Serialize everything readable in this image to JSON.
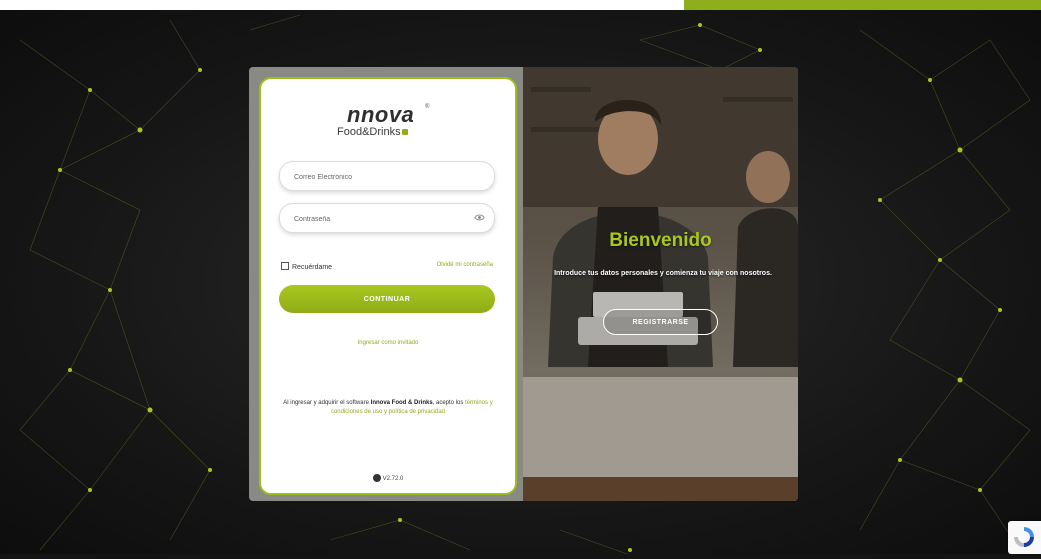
{
  "brand": {
    "logo_name": "nnova",
    "logo_sub": "Food&Drinks",
    "registered": "®",
    "accent_color": "#8fae1b"
  },
  "login": {
    "email_placeholder": "Correo Electrónico",
    "password_placeholder": "Contraseña",
    "remember_label": "Recuérdame",
    "forgot_label": "Olvidé mi contraseña",
    "continue_label": "CONTINUAR",
    "guest_label": "Ingresar como invitado",
    "terms_prefix": "Al ingresar y adquirir el software ",
    "terms_brand": "Innova Food & Drinks",
    "terms_middle": ", acepto los ",
    "terms_link": "términos y condiciones de uso y política de privacidad",
    "version": "V2.72.0"
  },
  "welcome": {
    "title": "Bienvenido",
    "text": "Introduce tus datos personales y comienza tu viaje con nosotros.",
    "register_label": "REGISTRARSE"
  },
  "icons": {
    "eye": "eye-icon",
    "version": "version-icon",
    "recaptcha": "recaptcha-icon"
  }
}
